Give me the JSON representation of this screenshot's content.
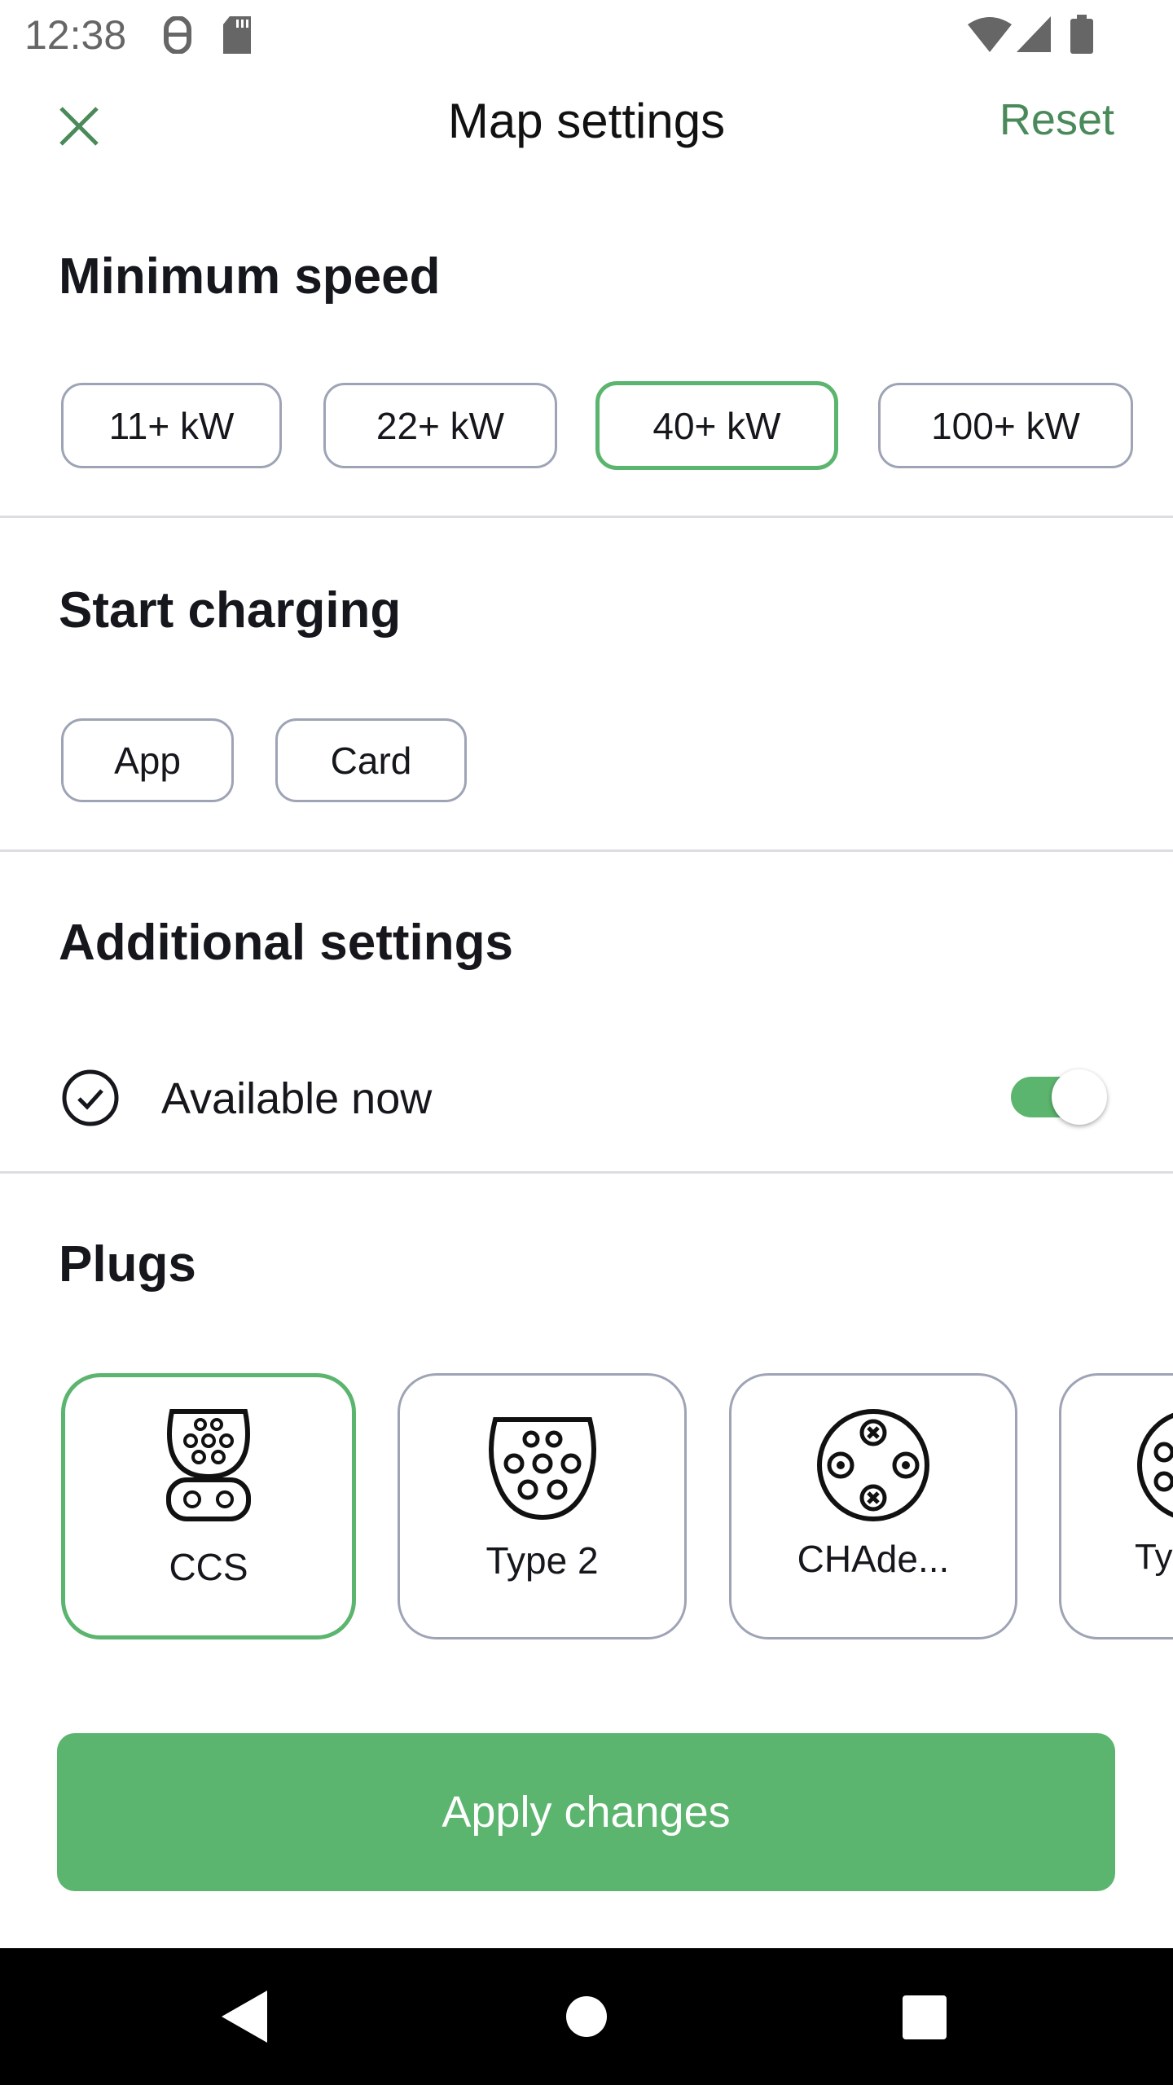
{
  "status_bar": {
    "time": "12:38",
    "icons": [
      "android-debug-icon",
      "sd-card-icon",
      "wifi-icon",
      "signal-icon",
      "battery-icon"
    ]
  },
  "header": {
    "title": "Map settings",
    "reset_label": "Reset",
    "close_icon": "close-icon"
  },
  "minimum_speed": {
    "title": "Minimum speed",
    "options": [
      "11+ kW",
      "22+ kW",
      "40+ kW",
      "100+ kW"
    ],
    "selected": "40+ kW"
  },
  "start_charging": {
    "title": "Start charging",
    "options": [
      "App",
      "Card"
    ]
  },
  "additional_settings": {
    "title": "Additional settings",
    "available_now": {
      "label": "Available now",
      "enabled": true
    }
  },
  "plugs": {
    "title": "Plugs",
    "items": [
      {
        "label": "CCS",
        "selected": true
      },
      {
        "label": "Type 2",
        "selected": false
      },
      {
        "label": "CHAde...",
        "selected": false
      },
      {
        "label": "Ty",
        "selected": false
      }
    ]
  },
  "apply_label": "Apply changes",
  "colors": {
    "accent": "#5cb56e",
    "accent_text": "#4a8a5a",
    "border": "#9ea4b5"
  }
}
